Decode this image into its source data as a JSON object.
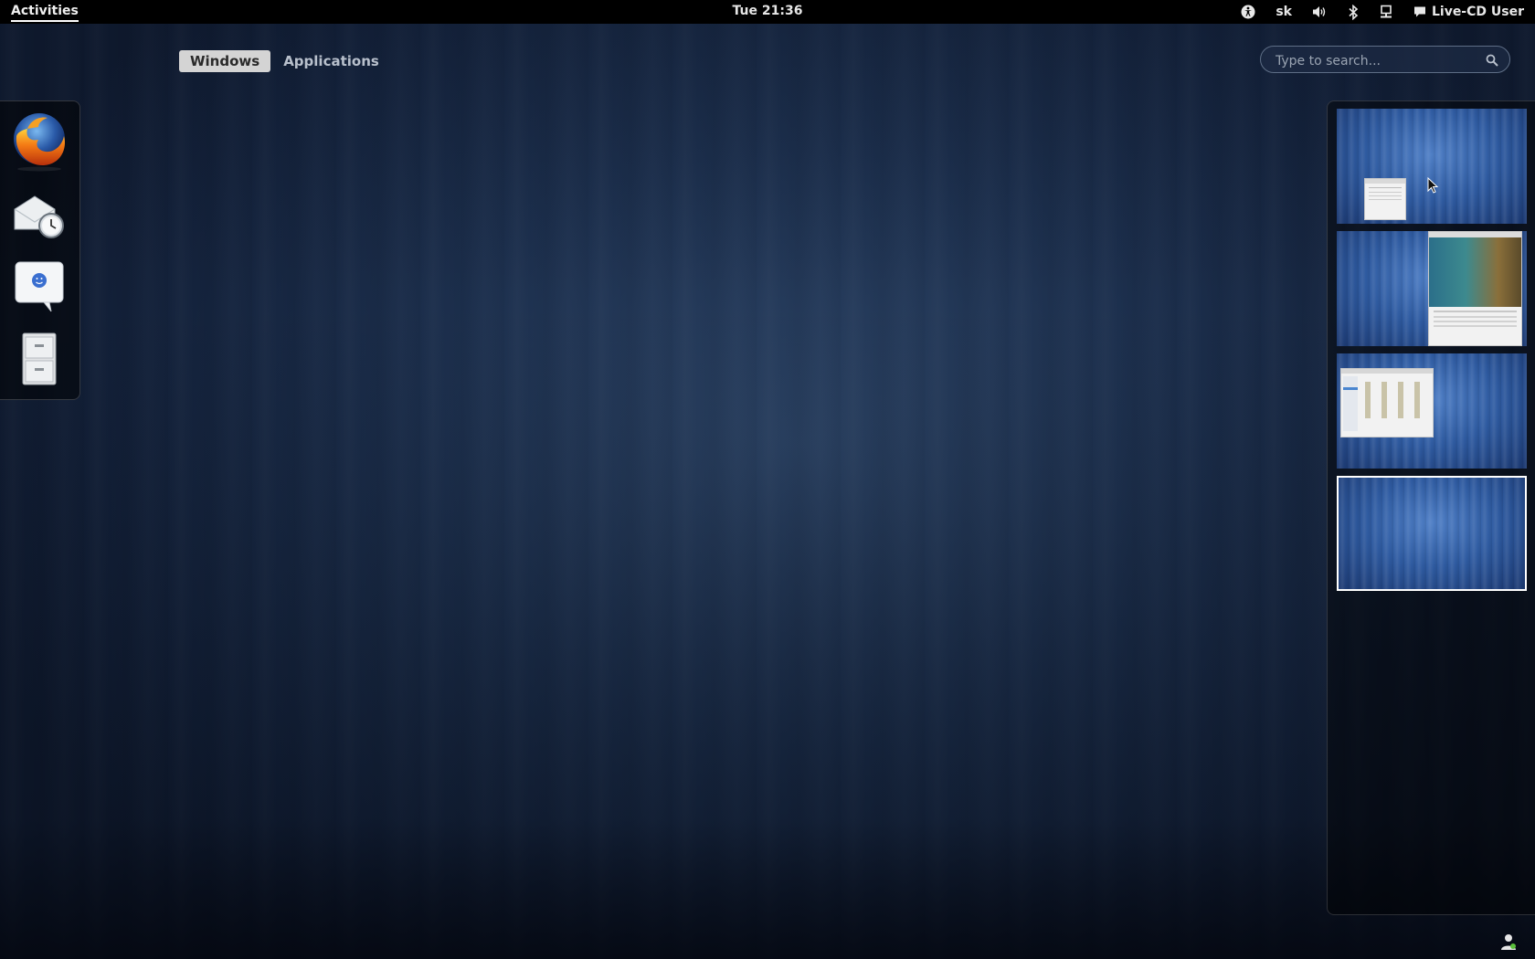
{
  "topbar": {
    "activities": "Activities",
    "clock": "Tue 21:36",
    "keyboard_layout": "sk",
    "user": "Live-CD User",
    "icons": [
      "accessibility-icon",
      "volume-icon",
      "bluetooth-icon",
      "network-icon",
      "chat-icon"
    ]
  },
  "view_selector": {
    "tabs": [
      {
        "label": "Windows",
        "active": true
      },
      {
        "label": "Applications",
        "active": false
      }
    ]
  },
  "search": {
    "placeholder": "Type to search..."
  },
  "dash": {
    "apps": [
      {
        "icon": "firefox-icon"
      },
      {
        "icon": "evolution-mail-icon"
      },
      {
        "icon": "empathy-chat-icon"
      },
      {
        "icon": "file-cabinet-icon"
      }
    ]
  },
  "workspaces": {
    "count": 4,
    "active_index": 3,
    "thumbnails": [
      {
        "content": "small file window"
      },
      {
        "content": "firefox welcome window"
      },
      {
        "content": "file manager window"
      },
      {
        "content": "empty"
      }
    ]
  },
  "colors": {
    "topbar_bg": "#000000",
    "desktop_bg": "#1c2f4d",
    "workspace_active_border": "#ffffff",
    "tab_active_bg": "#d4d4d4"
  }
}
